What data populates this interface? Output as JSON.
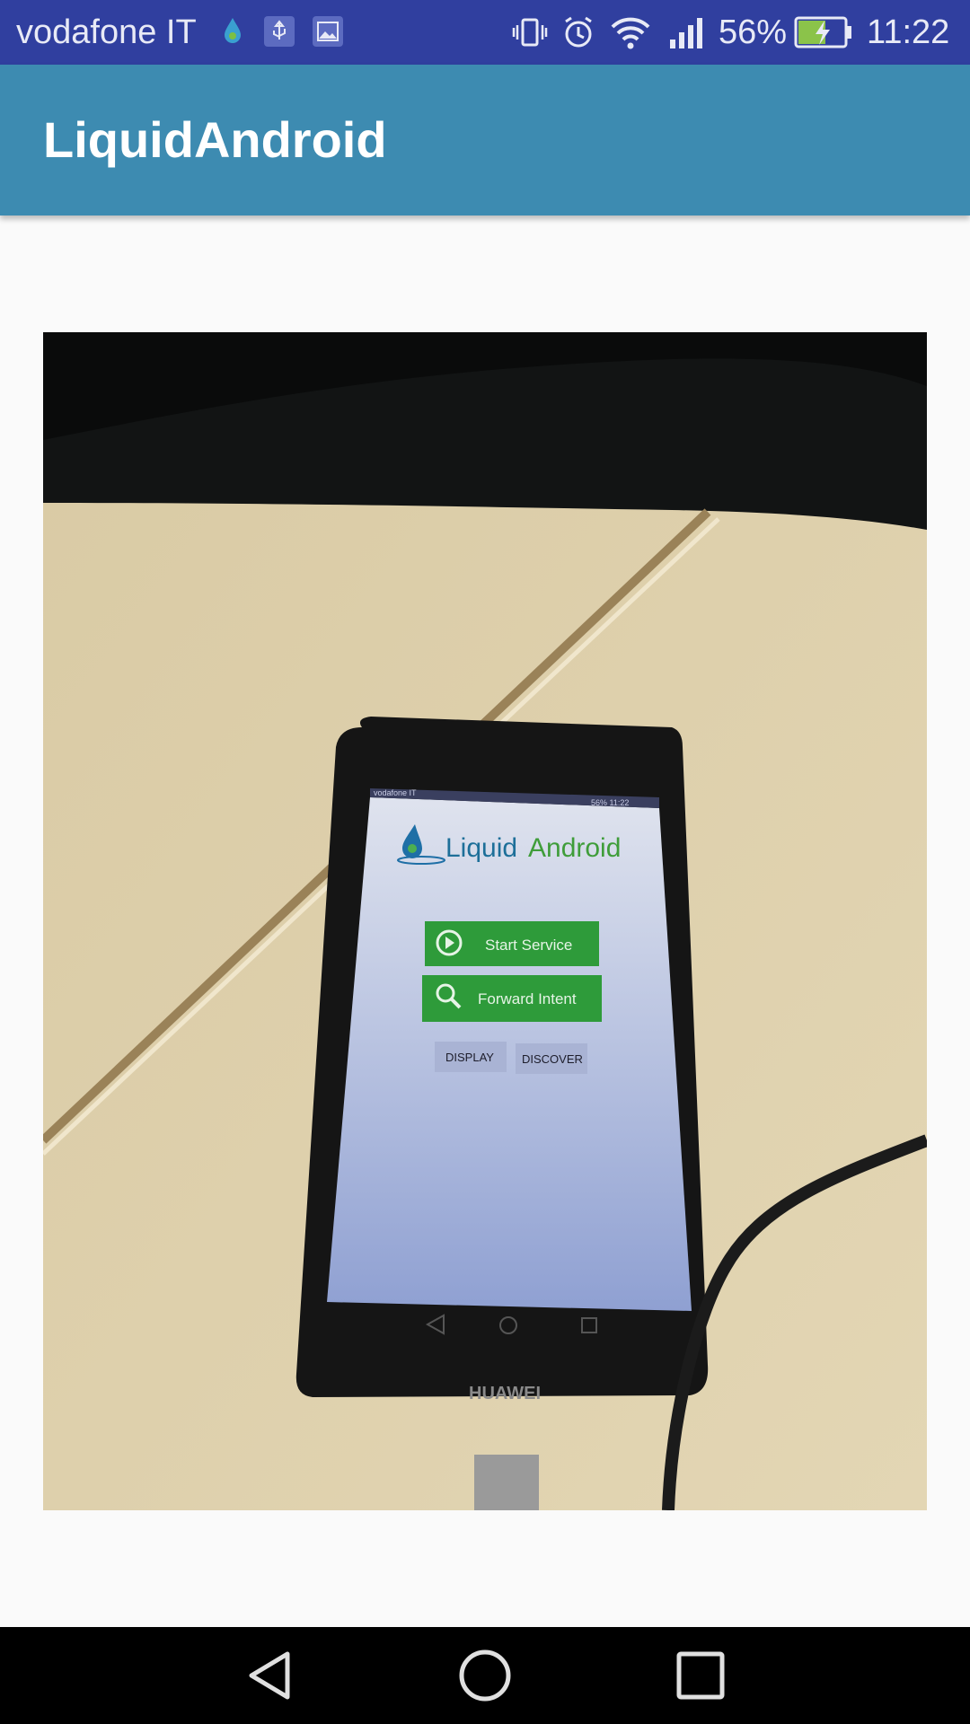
{
  "status_bar": {
    "carrier": "vodafone IT",
    "battery_percent": "56%",
    "time": "11:22",
    "icons": [
      "liquidandroid-drop-icon",
      "usb-icon",
      "image-icon",
      "vibrate-icon",
      "alarm-icon",
      "wifi-icon",
      "signal-icon",
      "battery-charging-icon"
    ]
  },
  "app_bar": {
    "title": "LiquidAndroid"
  },
  "photo": {
    "phone_brand": "HUAWEI",
    "inner_app": {
      "logo_text_a": "Liquid",
      "logo_text_b": "Android",
      "start_service_label": "Start Service",
      "forward_intent_label": "Forward Intent",
      "display_label": "DISPLAY",
      "discover_label": "DISCOVER",
      "inner_status_carrier": "vodafone IT",
      "inner_status_right": "56%  11:22"
    }
  },
  "nav_bar": {
    "back": "back-icon",
    "home": "home-icon",
    "recents": "recents-icon"
  },
  "colors": {
    "status_bar": "#303f9f",
    "app_bar": "#3d8bb1",
    "button_green": "#2e9b3a"
  }
}
